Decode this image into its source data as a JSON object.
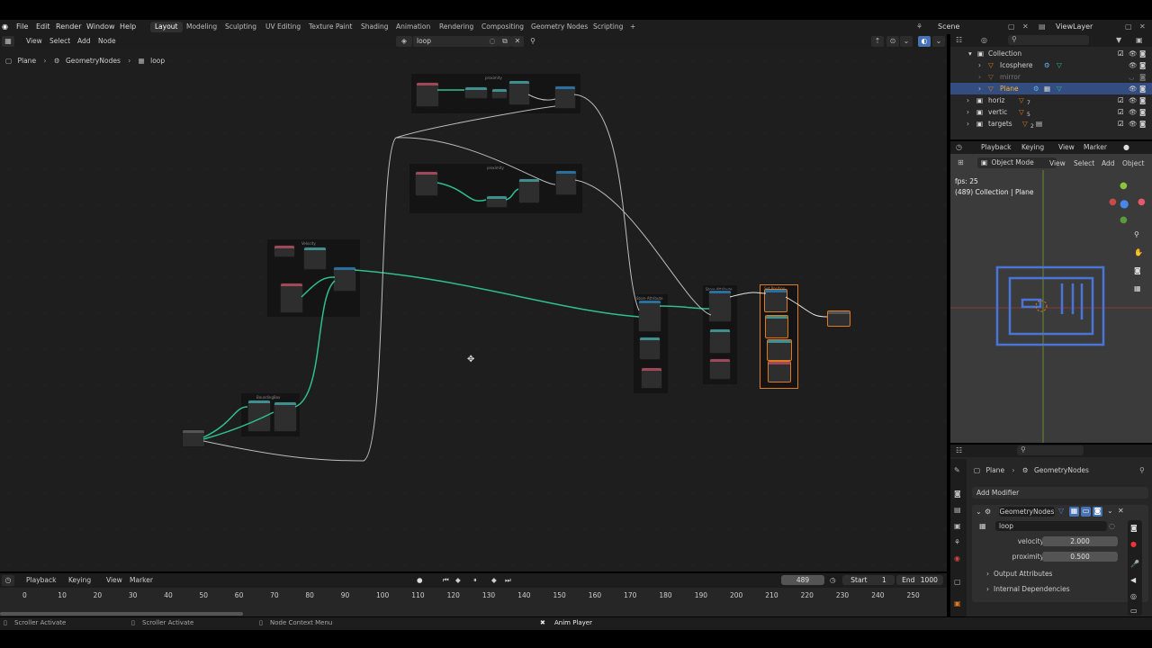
{
  "topbar": {
    "menus": [
      "File",
      "Edit",
      "Render",
      "Window",
      "Help"
    ],
    "workspaces": [
      "Layout",
      "Modeling",
      "Sculpting",
      "UV Editing",
      "Texture Paint",
      "Shading",
      "Animation",
      "Rendering",
      "Compositing",
      "Geometry Nodes",
      "Scripting"
    ],
    "active_workspace": "Layout",
    "add_tab": "+",
    "scene": "Scene",
    "view_layer": "ViewLayer"
  },
  "node_editor": {
    "menus": [
      "View",
      "Select",
      "Add",
      "Node"
    ],
    "node_group": "loop",
    "breadcrumb": [
      "Plane",
      "GeometryNodes",
      "loop"
    ],
    "frame_labels": [
      "proximity",
      "proximity",
      "Velocity",
      "BoundingBox",
      "Store Attribute",
      "Store Attribute",
      "Set Position"
    ]
  },
  "outliner": {
    "rows": [
      {
        "label": "Collection",
        "indent": 1
      },
      {
        "label": "Icosphere",
        "indent": 2
      },
      {
        "label": "mirror",
        "indent": 2
      },
      {
        "label": "Plane",
        "indent": 2,
        "selected": true
      },
      {
        "label": "horiz",
        "indent": 1
      },
      {
        "label": "vertic",
        "indent": 1
      },
      {
        "label": "targets",
        "indent": 1
      }
    ],
    "badges": {
      "horiz": "7",
      "vertic": "5",
      "targets": "2"
    }
  },
  "viewport": {
    "header_menus": [
      "Playback",
      "Keying",
      "View",
      "Marker"
    ],
    "mode": "Object Mode",
    "menus": [
      "View",
      "Select",
      "Add",
      "Object"
    ],
    "fps": "fps: 25",
    "collection_info": "(489) Collection | Plane"
  },
  "properties": {
    "breadcrumb": [
      "Plane",
      "GeometryNodes"
    ],
    "add_modifier": "Add Modifier",
    "modifier_name": "GeometryNodes",
    "node_group": "loop",
    "inputs": [
      {
        "label": "velocity",
        "value": "2.000"
      },
      {
        "label": "proximity",
        "value": "0.500"
      }
    ],
    "panels": [
      "Output Attributes",
      "Internal Dependencies"
    ]
  },
  "timeline": {
    "menus": [
      "Playback",
      "Keying",
      "View",
      "Marker"
    ],
    "current_frame": "489",
    "start_label": "Start",
    "start_value": "1",
    "end_label": "End",
    "end_value": "1000",
    "ticks": [
      "0",
      "10",
      "20",
      "30",
      "40",
      "50",
      "60",
      "70",
      "80",
      "90",
      "100",
      "110",
      "120",
      "130",
      "140",
      "150",
      "160",
      "170",
      "180",
      "190",
      "200",
      "210",
      "220",
      "230",
      "240",
      "250"
    ]
  },
  "status": {
    "left": "Scroller Activate",
    "middle": "Scroller Activate",
    "context": "Node Context Menu",
    "anim": "Anim Player"
  },
  "colors": {
    "accent": "#4772b3",
    "link_green": "#2fbf8f",
    "selected_row": "#334d80",
    "node_header_red": "#a0485a",
    "node_header_teal": "#3f8f8f",
    "orange_select": "#e07a1e"
  }
}
